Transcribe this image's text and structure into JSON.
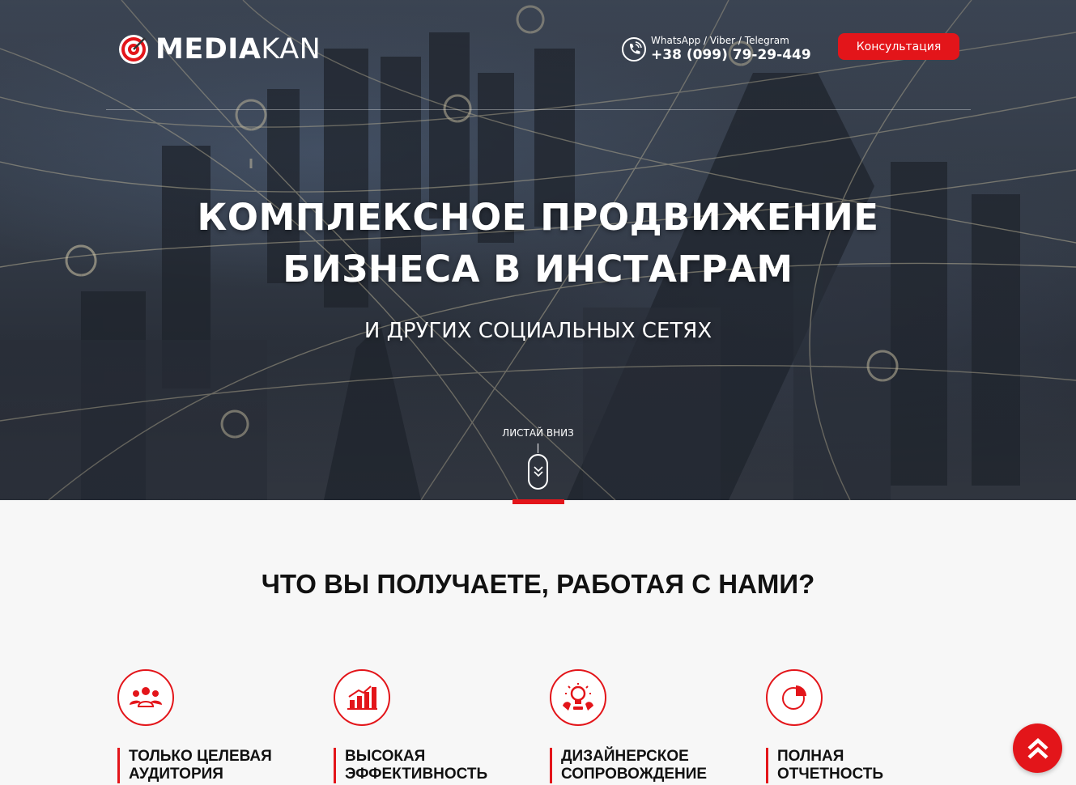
{
  "header": {
    "logo_bold": "MEDIA",
    "logo_thin": "KAN",
    "contact_channels": "WhatsApp / Viber / Telegram",
    "phone": "+38 (099) 79-29-449",
    "consult_label": "Консультация"
  },
  "hero": {
    "title_line1": "КОМПЛЕКСНОЕ ПРОДВИЖЕНИЕ",
    "title_line2": "БИЗНЕСА В ИНСТАГРАМ",
    "subtitle": "И ДРУГИХ СОЦИАЛЬНЫХ СЕТЯХ",
    "scroll_label": "ЛИСТАЙ ВНИЗ"
  },
  "benefits": {
    "title": "ЧТО ВЫ ПОЛУЧАЕТЕ, РАБОТАЯ С НАМИ?",
    "items": [
      {
        "label": "ТОЛЬКО ЦЕЛЕВАЯ\nАУДИТОРИЯ",
        "icon": "audience-icon"
      },
      {
        "label": "ВЫСОКАЯ\nЭФФЕКТИВНОСТЬ",
        "icon": "bar-chart-icon"
      },
      {
        "label": "ДИЗАЙНЕРСКОЕ\nСОПРОВОЖДЕНИЕ",
        "icon": "lightbulb-icon"
      },
      {
        "label": "ПОЛНАЯ\nОТЧЕТНОСТЬ",
        "icon": "pie-chart-icon"
      }
    ]
  },
  "colors": {
    "accent": "#e3151a",
    "hero_overlay": "#3a4350",
    "section_bg": "#f7f7f7"
  }
}
